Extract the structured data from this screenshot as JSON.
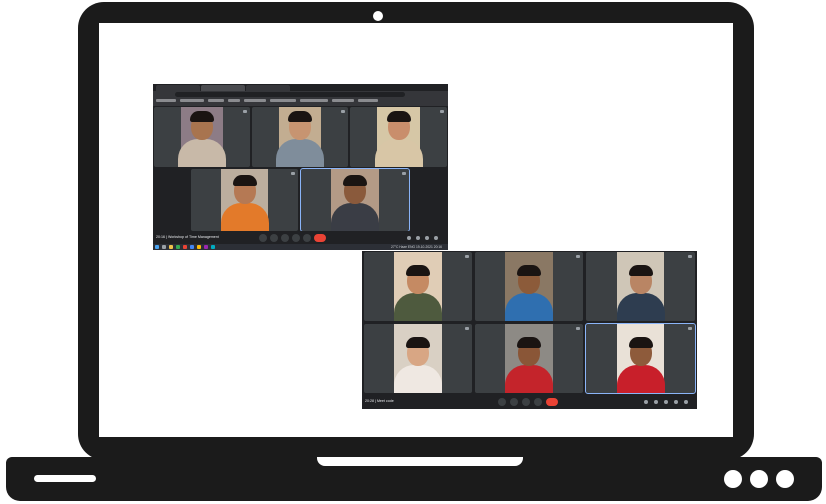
{
  "window_top": {
    "meeting_time": "20:16",
    "meeting_title": "Workshop of Time Management",
    "taskbar_clock": "27°C  Haze  ENG  19-10-2021 20:16",
    "participants": [
      {
        "name": "",
        "bg": "#8d7c86",
        "skin": "#a8744f",
        "shirt": "#c8b9a8"
      },
      {
        "name": "",
        "bg": "#c2ad91",
        "skin": "#c79471",
        "shirt": "#7f8d9b"
      },
      {
        "name": "",
        "bg": "#d6c7a6",
        "skin": "#c98e6c",
        "shirt": "#d8c6a6"
      },
      {
        "name": "",
        "bg": "#bcae9e",
        "skin": "#b57954",
        "shirt": "#e37a2a"
      },
      {
        "name": "",
        "bg": "#b39a86",
        "skin": "#8a5a3c",
        "shirt": "#3a3d45"
      }
    ]
  },
  "window_bottom": {
    "meeting_time": "20:28",
    "meeting_title": "Meet code",
    "participants": [
      {
        "name": "",
        "bg": "#e0cdb6",
        "skin": "#c58a63",
        "shirt": "#4e5a3e"
      },
      {
        "name": "",
        "bg": "#8a7864",
        "skin": "#8c5b3a",
        "shirt": "#2f6fb0"
      },
      {
        "name": "",
        "bg": "#cfc6b7",
        "skin": "#b98564",
        "shirt": "#2e3d50"
      },
      {
        "name": "",
        "bg": "#d9d0c4",
        "skin": "#d8a684",
        "shirt": "#efe8e2"
      },
      {
        "name": "",
        "bg": "#8d8a85",
        "skin": "#8a5637",
        "shirt": "#c4242b"
      },
      {
        "name": "",
        "bg": "#e9e1d7",
        "skin": "#8e5b3b",
        "shirt": "#c81f2a"
      }
    ]
  },
  "colors": {
    "end_call": "#ea4335",
    "active_speaker": "#8ab4f8",
    "laptop": "#1b1b1b"
  },
  "icons": [
    "camera-icon",
    "mic-icon",
    "video-icon",
    "captions-icon",
    "present-icon",
    "more-icon",
    "end-call-icon",
    "info-icon",
    "people-icon",
    "chat-icon",
    "activities-icon"
  ]
}
